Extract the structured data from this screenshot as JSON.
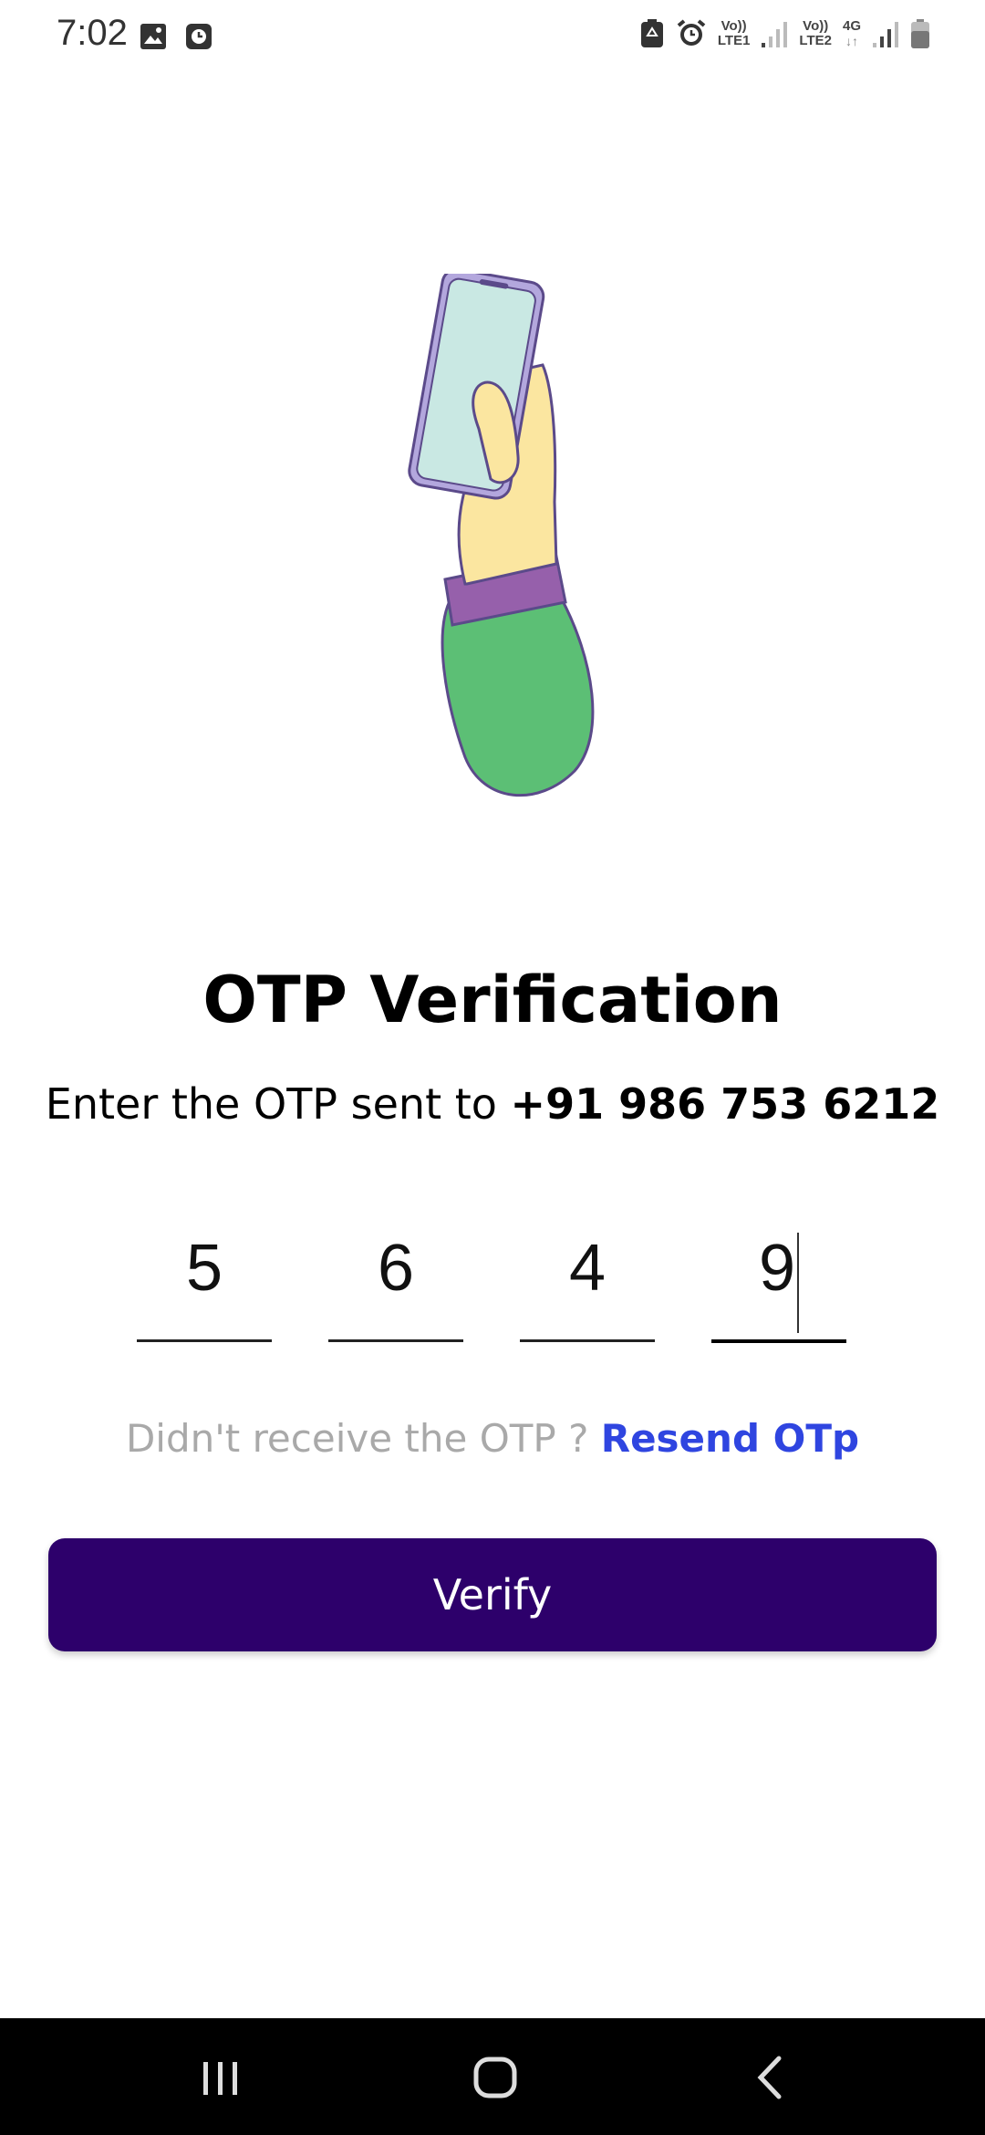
{
  "status_bar": {
    "time": "7:02",
    "left_icons": [
      "image-icon",
      "clock-app-icon"
    ],
    "right_icons": [
      "recycle-icon",
      "alarm-icon",
      "signal-icon",
      "signal-icon",
      "battery-icon"
    ],
    "sim1_label_top": "Vo))",
    "sim1_label_bottom": "LTE1",
    "sim2_label_top": "Vo))",
    "sim2_label_bottom": "LTE2",
    "network_type": "4G"
  },
  "illustration": {
    "icon": "hand-holding-phone-illustration",
    "colors": {
      "phone_screen": "#c9e8e3",
      "phone_frame": "#b3a7dd",
      "hand": "#fbe6a0",
      "cuff": "#9660ab",
      "sleeve": "#5cbf75",
      "outline": "#5b4a8a"
    }
  },
  "main": {
    "title": "OTP Verification",
    "subtitle_prefix": "Enter the OTP sent to ",
    "phone_number": "+91 986 753 6212"
  },
  "otp": {
    "digits": [
      "5",
      "6",
      "4",
      "9"
    ],
    "active_index": 3
  },
  "resend": {
    "prompt": "Didn't receive the OTP ? ",
    "link_label": "Resend OTp",
    "link_color": "#2f45e0"
  },
  "verify_button": {
    "label": "Verify",
    "background": "#2d006b"
  },
  "nav_bar": {
    "recents": "recents-icon",
    "home": "home-icon",
    "back": "back-icon"
  }
}
